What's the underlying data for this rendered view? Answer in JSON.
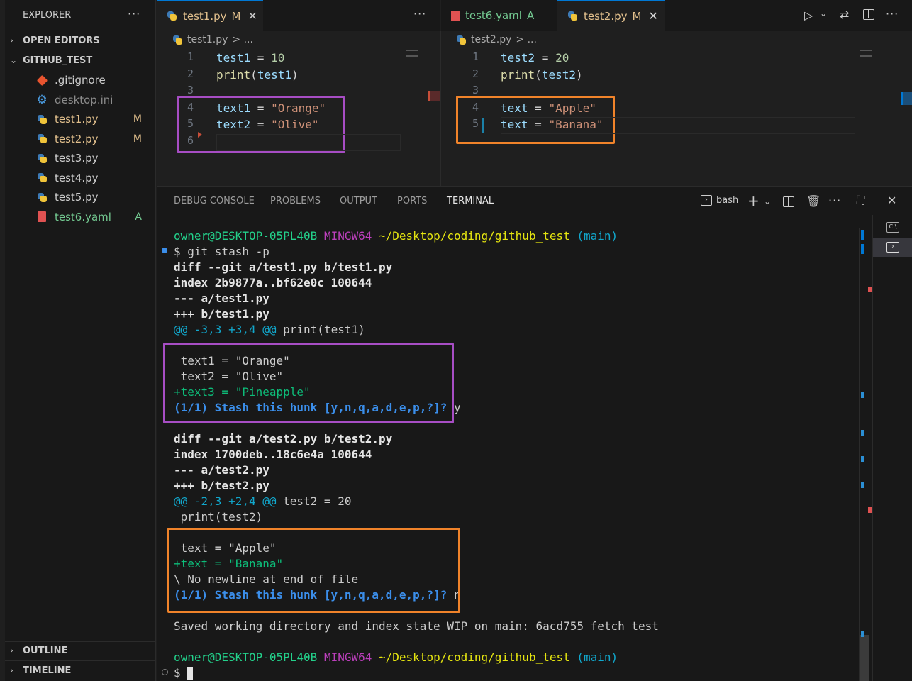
{
  "sidebar": {
    "title": "EXPLORER",
    "more": "···",
    "open_editors": "OPEN EDITORS",
    "folder": "GITHUB_TEST",
    "files": [
      {
        "name": ".gitignore",
        "icon": "git-icon",
        "badge": "",
        "color": "#cccccc"
      },
      {
        "name": "desktop.ini",
        "icon": "gear-icon",
        "badge": "",
        "color": "#8b8b8b"
      },
      {
        "name": "test1.py",
        "icon": "python-icon",
        "badge": "M",
        "color": "#e2c08d"
      },
      {
        "name": "test2.py",
        "icon": "python-icon",
        "badge": "M",
        "color": "#e2c08d"
      },
      {
        "name": "test3.py",
        "icon": "python-icon",
        "badge": "",
        "color": "#cccccc"
      },
      {
        "name": "test4.py",
        "icon": "python-icon",
        "badge": "",
        "color": "#cccccc"
      },
      {
        "name": "test5.py",
        "icon": "python-icon",
        "badge": "",
        "color": "#cccccc"
      },
      {
        "name": "test6.yaml",
        "icon": "yaml-icon",
        "badge": "A",
        "color": "#73c991"
      }
    ],
    "outline": "OUTLINE",
    "timeline": "TIMELINE"
  },
  "editor1": {
    "tab": {
      "name": "test1.py",
      "badge": "M"
    },
    "more": "···",
    "crumb_file": "test1.py",
    "crumb_rest": "> ...",
    "lines": [
      {
        "n": "1",
        "var": "test1",
        "op": " = ",
        "val": "10",
        "kind": "num"
      },
      {
        "n": "2",
        "fn": "print",
        "arg": "test1"
      },
      {
        "n": "3"
      },
      {
        "n": "4",
        "var": "text1",
        "op": " = ",
        "val": "\"Orange\"",
        "kind": "str"
      },
      {
        "n": "5",
        "var": "text2",
        "op": " = ",
        "val": "\"Olive\"",
        "kind": "str"
      },
      {
        "n": "6"
      }
    ]
  },
  "editor2": {
    "tabs": [
      {
        "name": "test6.yaml",
        "badge": "A"
      },
      {
        "name": "test2.py",
        "badge": "M"
      }
    ],
    "crumb_file": "test2.py",
    "crumb_rest": "> ...",
    "lines": [
      {
        "n": "1",
        "var": "test2",
        "op": " = ",
        "val": "20",
        "kind": "num"
      },
      {
        "n": "2",
        "fn": "print",
        "arg": "test2"
      },
      {
        "n": "3"
      },
      {
        "n": "4",
        "var": "text",
        "op": " = ",
        "val": "\"Apple\"",
        "kind": "str"
      },
      {
        "n": "5",
        "var": "text",
        "op": " = ",
        "val": "\"Banana\"",
        "kind": "str"
      }
    ]
  },
  "panel": {
    "tabs": [
      "DEBUG CONSOLE",
      "PROBLEMS",
      "OUTPUT",
      "PORTS",
      "TERMINAL"
    ],
    "active_tab": "TERMINAL",
    "shell": "bash"
  },
  "terminal": {
    "prompt_user": "owner@DESKTOP-05PL40B",
    "prompt_env": "MINGW64",
    "prompt_path": "~/Desktop/coding/github_test",
    "prompt_branch": "(main)",
    "command": "$ git stash -p",
    "diff1": [
      "diff --git a/test1.py b/test1.py",
      "index 2b9877a..bf62e0c 100644",
      "--- a/test1.py",
      "+++ b/test1.py"
    ],
    "hunk1_at": "@@ -3,3 +3,4 @@",
    "hunk1_ctx": " print(test1)",
    "hunk1_lines": [
      " text1 = \"Orange\"",
      " text2 = \"Olive\""
    ],
    "hunk1_add": "+text3 = \"Pineapple\"",
    "prompt_q": "(1/1) Stash this hunk [y,n,q,a,d,e,p,?]?",
    "answer1": " y",
    "diff2": [
      "diff --git a/test2.py b/test2.py",
      "index 1700deb..18c6e4a 100644",
      "--- a/test2.py",
      "+++ b/test2.py"
    ],
    "hunk2_at": "@@ -2,3 +2,4 @@",
    "hunk2_ctx": " test2 = 20",
    "hunk2_line0": " print(test2)",
    "hunk2_line1": " text = \"Apple\"",
    "hunk2_add": "+text = \"Banana\"",
    "no_newline": "\\ No newline at end of file",
    "answer2": " n",
    "saved": "Saved working directory and index state WIP on main: 6acd755 fetch test",
    "last_prompt": "$ "
  },
  "colors": {
    "purple_box": "#a74dc4",
    "orange_box": "#f0832a"
  }
}
